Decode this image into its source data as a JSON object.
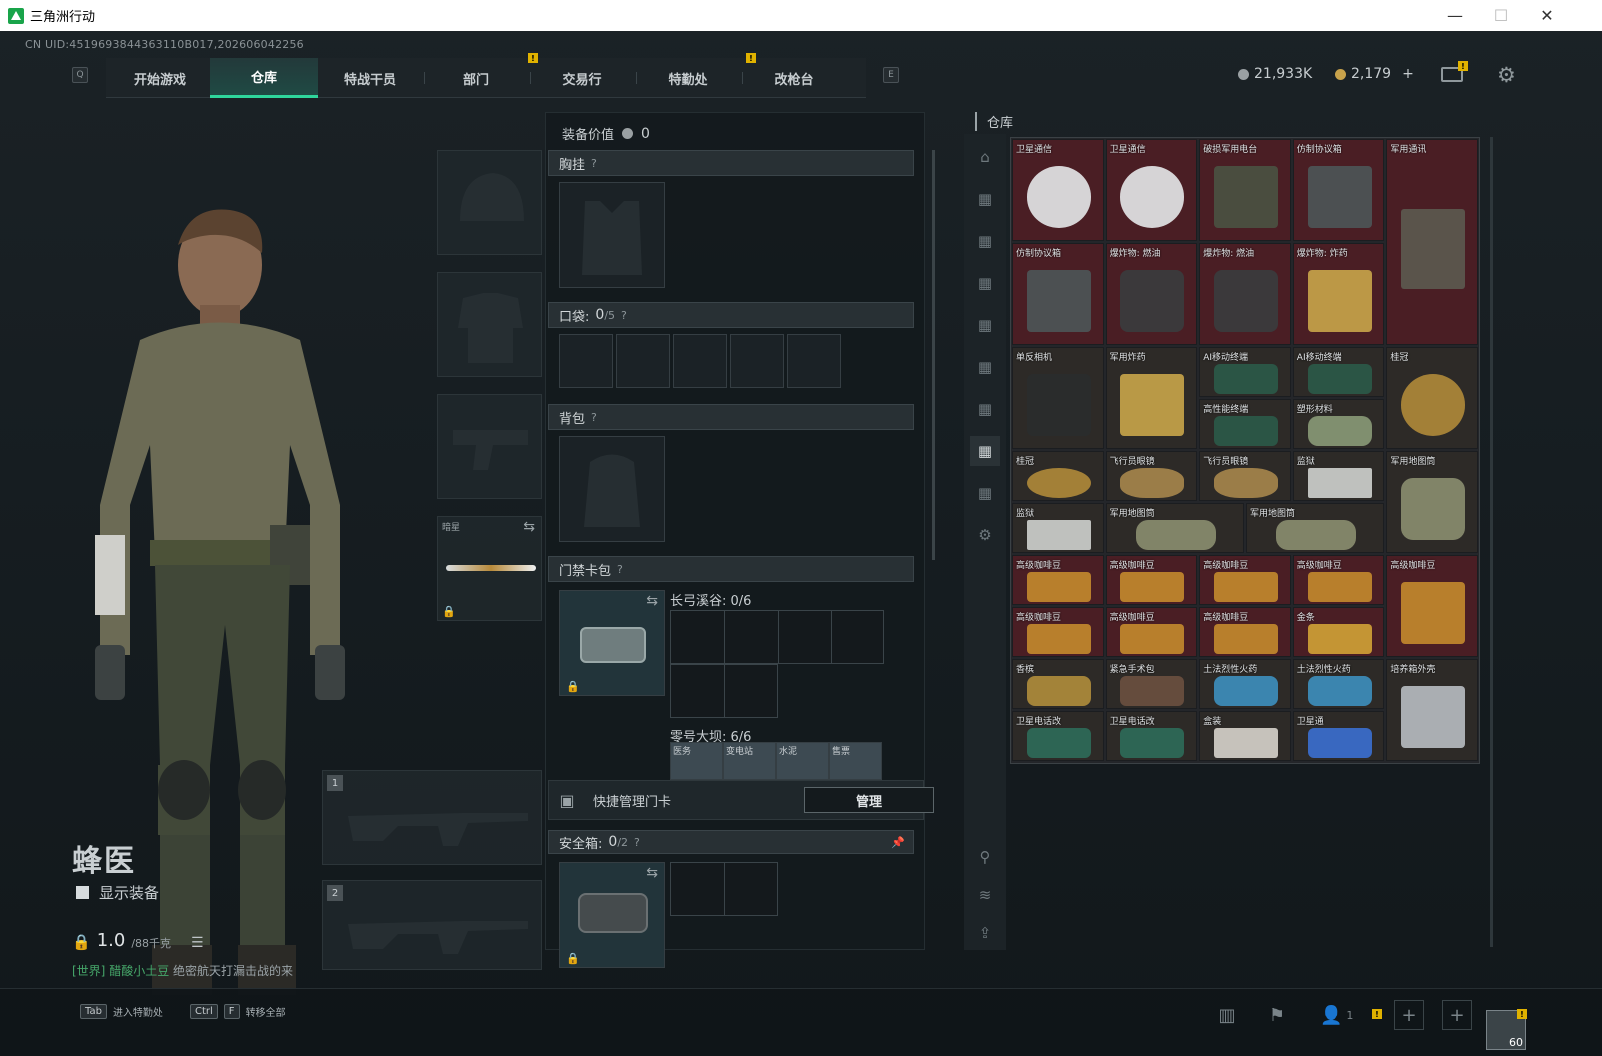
{
  "window": {
    "title": "三角洲行动",
    "minimize": "—",
    "maximize": "☐",
    "close": "✕"
  },
  "uid": "CN UID:4519693844363110B017,202606042256",
  "nav": {
    "left_key": "Q",
    "right_key": "E",
    "tabs": [
      {
        "label": "开始游戏",
        "active": false,
        "badge": false
      },
      {
        "label": "仓库",
        "active": true,
        "badge": false
      },
      {
        "label": "特战干员",
        "active": false,
        "badge": false
      },
      {
        "label": "部门",
        "active": false,
        "badge": true
      },
      {
        "label": "交易行",
        "active": false,
        "badge": false
      },
      {
        "label": "特勤处",
        "active": false,
        "badge": true
      },
      {
        "label": "改枪台",
        "active": false,
        "badge": false
      }
    ]
  },
  "currency": {
    "hafbucks": "21,933K",
    "coupons": "2,179",
    "plus": "+"
  },
  "operator": {
    "name": "蜂医",
    "show_equipment": "显示装备",
    "weight": "1.0",
    "weight_max": "/88千克"
  },
  "chat": {
    "channel": "[世界]",
    "user": "醋酸小土豆",
    "message": "绝密航天打漏击战的来"
  },
  "equipment": {
    "melee_label": "暗星",
    "weapon1_index": "1",
    "weapon2_index": "2"
  },
  "loadout": {
    "value_label": "装备价值",
    "value": "0",
    "chest_rig": "胸挂",
    "pocket_label": "口袋:",
    "pocket_count": "0",
    "pocket_max": "/5",
    "backpack": "背包",
    "keycard_bag": "门禁卡包",
    "keycard_area1": "长弓溪谷: 0/6",
    "keycard_area2": "零号大坝: 6/6",
    "keycards": [
      "医务",
      "变电站",
      "水泥",
      "售票"
    ],
    "quick_manage": "快捷管理门卡",
    "manage_btn": "管理",
    "safebox_label": "安全箱:",
    "safebox_count": "0",
    "safebox_max": "/2",
    "help": "?"
  },
  "storage": {
    "title": "仓库",
    "items": [
      {
        "name": "卫星通信",
        "color": "red",
        "icon": "satellite-dish-icon"
      },
      {
        "name": "卫星通信",
        "color": "red",
        "icon": "satellite-dish-icon"
      },
      {
        "name": "破损军用电台",
        "color": "red",
        "icon": "radio-icon"
      },
      {
        "name": "仿制协议箱",
        "color": "red",
        "icon": "crate-icon"
      },
      {
        "name": "军用通讯",
        "color": "red",
        "icon": "comms-device-icon"
      },
      {
        "name": "仿制协议箱",
        "color": "red",
        "icon": "crate-icon"
      },
      {
        "name": "爆炸物: 燃油",
        "color": "red",
        "icon": "fuel-canister-icon"
      },
      {
        "name": "爆炸物: 燃油",
        "color": "red",
        "icon": "fuel-canister-icon"
      },
      {
        "name": "爆炸物: 炸药",
        "color": "red",
        "icon": "explosive-crate-icon"
      },
      {
        "name": "单反相机",
        "color": "dk",
        "icon": "camera-icon"
      },
      {
        "name": "军用炸药",
        "color": "dk",
        "icon": "explosive-crate-icon"
      },
      {
        "name": "AI移动终端",
        "color": "dk",
        "icon": "tablet-icon"
      },
      {
        "name": "AI移动终端",
        "color": "dk",
        "icon": "tablet-icon"
      },
      {
        "name": "高性能终端",
        "color": "dk",
        "icon": "tablet-icon"
      },
      {
        "name": "塑形材料",
        "color": "dk",
        "icon": "roll-icon"
      },
      {
        "name": "桂冠",
        "color": "dk",
        "icon": "laurel-icon"
      },
      {
        "name": "桂冠",
        "color": "dk",
        "icon": "laurel-icon"
      },
      {
        "name": "飞行员眼镜",
        "color": "dk",
        "icon": "sunglasses-icon"
      },
      {
        "name": "飞行员眼镜",
        "color": "dk",
        "icon": "sunglasses-icon"
      },
      {
        "name": "监狱",
        "color": "dk",
        "icon": "map-icon"
      },
      {
        "name": "军用地图筒",
        "color": "dk",
        "icon": "tube-icon"
      },
      {
        "name": "监狱",
        "color": "dk",
        "icon": "map-icon"
      },
      {
        "name": "军用地图筒",
        "color": "dk",
        "icon": "tube-icon"
      },
      {
        "name": "军用地图筒",
        "color": "dk",
        "icon": "tube-icon"
      },
      {
        "name": "高级咖啡豆",
        "color": "red",
        "icon": "coffee-bag-icon"
      },
      {
        "name": "高级咖啡豆",
        "color": "red",
        "icon": "coffee-bag-icon"
      },
      {
        "name": "高级咖啡豆",
        "color": "red",
        "icon": "coffee-bag-icon"
      },
      {
        "name": "高级咖啡豆",
        "color": "red",
        "icon": "coffee-bag-icon"
      },
      {
        "name": "高级咖啡豆",
        "color": "red",
        "icon": "coffee-bag-icon"
      },
      {
        "name": "高级咖啡豆",
        "color": "red",
        "icon": "coffee-bag-icon"
      },
      {
        "name": "高级咖啡豆",
        "color": "red",
        "icon": "coffee-bag-icon"
      },
      {
        "name": "高级咖啡豆",
        "color": "red",
        "icon": "coffee-bag-icon"
      },
      {
        "name": "金条",
        "color": "red",
        "icon": "gold-bar-icon"
      },
      {
        "name": "香槟",
        "color": "dk",
        "icon": "bottle-icon"
      },
      {
        "name": "紧急手术包",
        "color": "dk",
        "icon": "pouch-icon"
      },
      {
        "name": "土法烈性火药",
        "color": "dk",
        "icon": "powder-can-icon"
      },
      {
        "name": "土法烈性火药",
        "color": "dk",
        "icon": "powder-can-icon"
      },
      {
        "name": "培养箱外壳",
        "color": "dk",
        "icon": "case-icon"
      },
      {
        "name": "卫星电话改",
        "color": "dk",
        "icon": "phone-icon"
      },
      {
        "name": "卫星电话改",
        "color": "dk",
        "icon": "phone-icon"
      },
      {
        "name": "盒装",
        "color": "dk",
        "icon": "box-icon"
      },
      {
        "name": "卫星通",
        "color": "dk",
        "icon": "smartphone-icon"
      }
    ]
  },
  "bottom": {
    "tab_key": "Tab",
    "tab_label": "进入特勤处",
    "ctrl_key": "Ctrl",
    "f_key": "F",
    "transfer_label": "转移全部",
    "friends_count": "1",
    "level": "60"
  },
  "colors": {
    "accent": "#2fd69c",
    "badge": "#e0b200",
    "rare_red": "#4a1e24"
  }
}
